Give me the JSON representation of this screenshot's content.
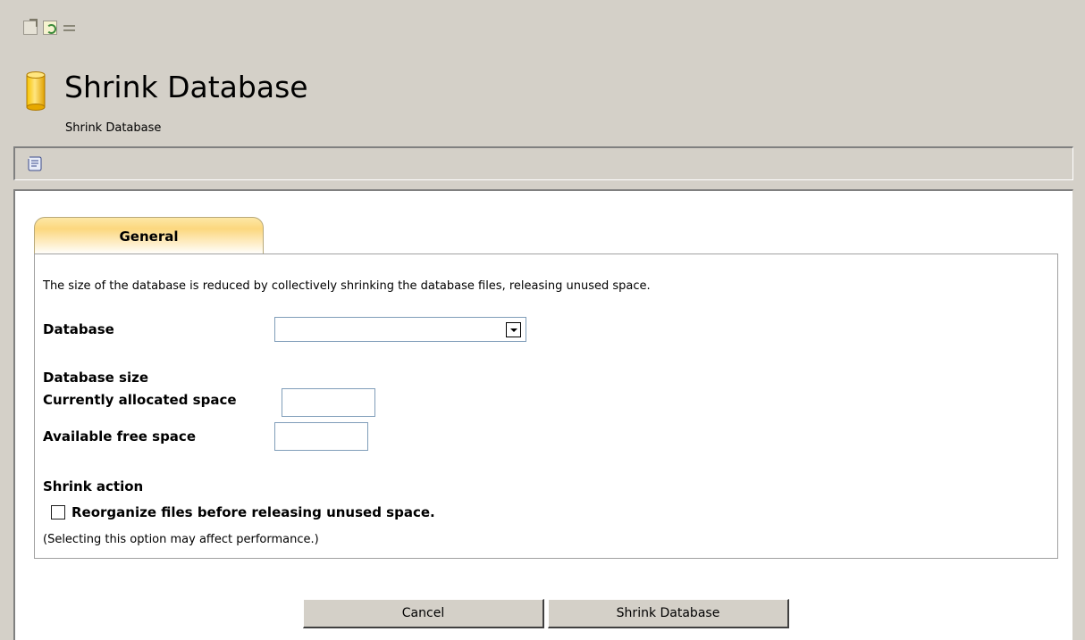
{
  "toolbar": {
    "icons": [
      "export-icon",
      "refresh-icon",
      "sync-icon"
    ]
  },
  "header": {
    "title": "Shrink Database",
    "subtitle": "Shrink Database"
  },
  "action_bar": {
    "icons": [
      "script-icon"
    ]
  },
  "tabs": [
    {
      "label": "General",
      "active": true
    }
  ],
  "form": {
    "description": "The size of the database is reduced by collectively shrinking the database files, releasing unused space.",
    "database_label": "Database",
    "database_value": "",
    "size_section_label": "Database size",
    "allocated_label": "Currently allocated space",
    "allocated_value": "",
    "free_label": "Available free space",
    "free_value": "",
    "action_section_label": "Shrink action",
    "reorganize_label": "Reorganize files before releasing unused space.",
    "reorganize_checked": false,
    "note": "(Selecting this option may affect performance.)"
  },
  "buttons": {
    "cancel_label": "Cancel",
    "shrink_label": "Shrink Database"
  },
  "colors": {
    "window_bg": "#d4d0c8",
    "tab_accent": "#fcd77e",
    "db_icon": "#f5b800"
  }
}
